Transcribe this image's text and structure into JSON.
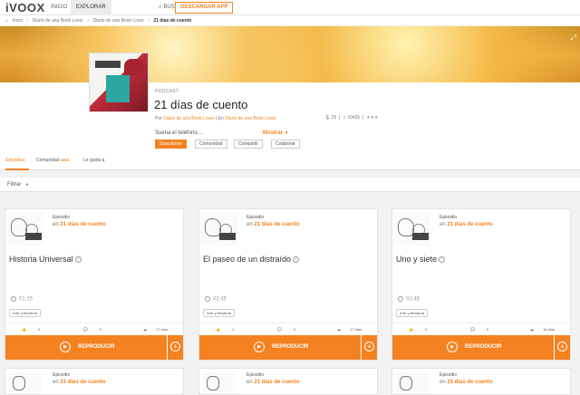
{
  "topbar": {
    "logo": "iVOOX",
    "nav": [
      "INICIO",
      "EXPLORAR"
    ],
    "search": "BUSCAR",
    "download": "DESCARGAR APP"
  },
  "breadcrumb": [
    "Inicio",
    "Diario de una Book Lover",
    "Diario de una Book Lover",
    "21 días de cuento"
  ],
  "podcast": {
    "label": "PODCAST",
    "title": "21 días de cuento",
    "by_prefix": "Por",
    "author": "Diario de una Book Lover",
    "en_prefix": "| En",
    "channel": "Diario de una Book Lover",
    "mic_count": "25",
    "plays": "10425",
    "rating": "★★★",
    "description": "Suena el teléfono....",
    "show_more": "Mostrar",
    "buttons": [
      "Suscribirse",
      "Comunidad",
      "Compartir",
      "Colaborar"
    ]
  },
  "tabs": {
    "episodes": "Episodios",
    "community": "Comunidad",
    "new_badge": "NEW",
    "likes": "Le gusta a"
  },
  "filter": "Filtrar",
  "card_common": {
    "episode_label": "Episodio",
    "in_prefix": "en",
    "podcast_name": "21 días de cuento",
    "tag": "Arte y literatura",
    "play": "REPRODUCIR"
  },
  "episodes": [
    {
      "title": "Historia Universal",
      "duration": "01:15",
      "likes": "0",
      "comments": "0",
      "age": "17 días"
    },
    {
      "title": "El paseo de un distraído",
      "duration": "02:45",
      "likes": "1",
      "comments": "0",
      "age": "17 días"
    },
    {
      "title": "Uno y siete",
      "duration": "01:45",
      "likes": "0",
      "comments": "0",
      "age": "18 días"
    }
  ],
  "colors": {
    "accent": "#f58220"
  }
}
